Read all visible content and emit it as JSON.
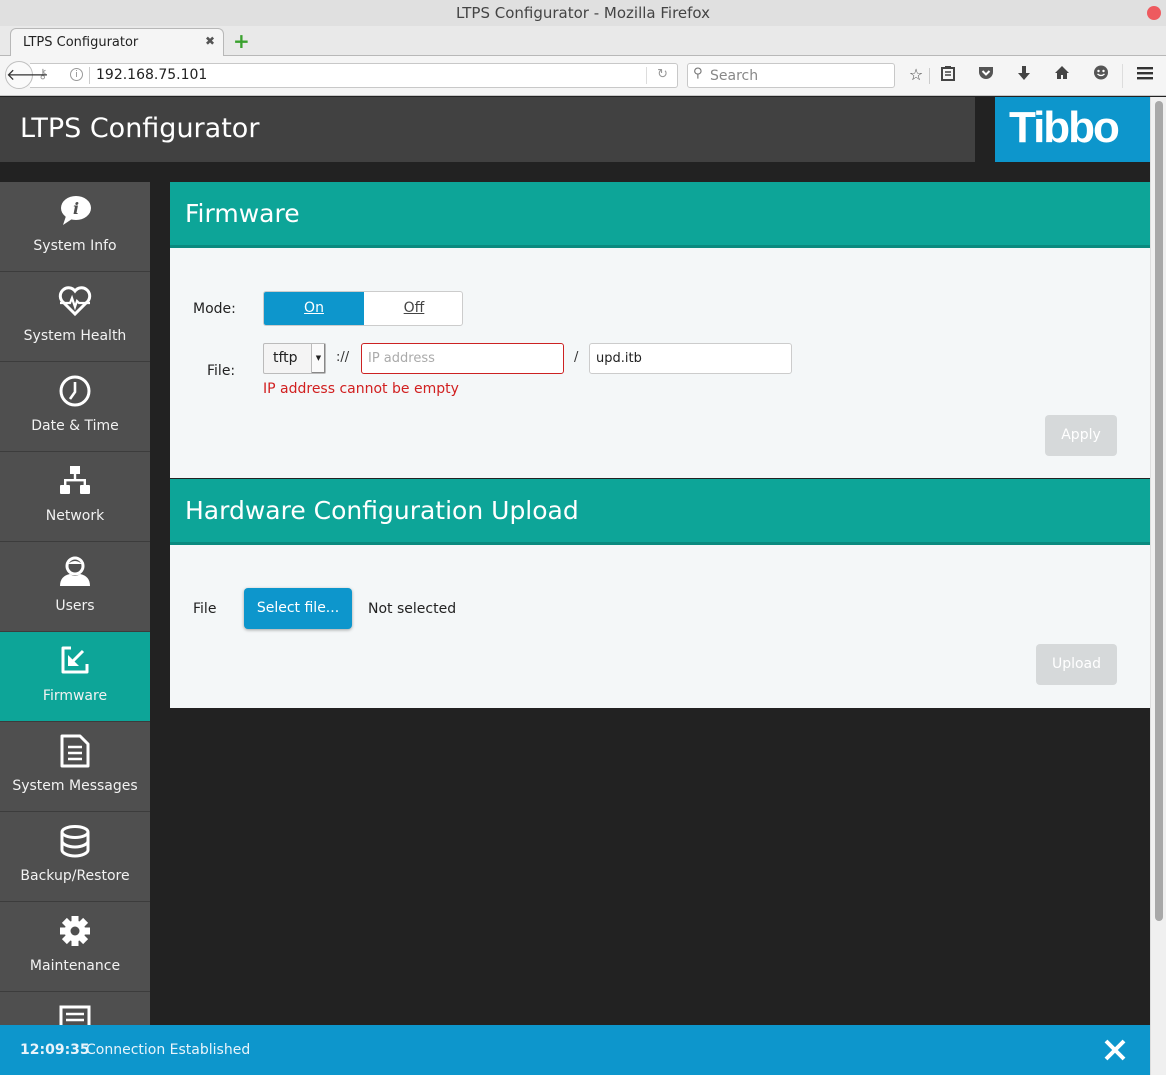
{
  "browser": {
    "window_title": "LTPS Configurator - Mozilla Firefox",
    "tab_title": "LTPS Configurator",
    "url": "192.168.75.101",
    "search_placeholder": "Search",
    "toolbar_icons": [
      "bookmark-star-icon",
      "reading-list-icon",
      "pocket-icon",
      "download-icon",
      "home-icon",
      "hello-chat-icon",
      "hamburger-menu-icon"
    ]
  },
  "app": {
    "title": "LTPS Configurator",
    "logo": "Tibbo"
  },
  "sidebar": {
    "items": [
      {
        "label": "System Info",
        "icon": "info-bubble-icon",
        "active": false
      },
      {
        "label": "System Health",
        "icon": "heart-pulse-icon",
        "active": false
      },
      {
        "label": "Date & Time",
        "icon": "clock-icon",
        "active": false
      },
      {
        "label": "Network",
        "icon": "network-tree-icon",
        "active": false
      },
      {
        "label": "Users",
        "icon": "user-icon",
        "active": false
      },
      {
        "label": "Firmware",
        "icon": "firmware-download-icon",
        "active": true
      },
      {
        "label": "System Messages",
        "icon": "document-icon",
        "active": false
      },
      {
        "label": "Backup/Restore",
        "icon": "database-icon",
        "active": false
      },
      {
        "label": "Maintenance",
        "icon": "gear-icon",
        "active": false
      },
      {
        "label": "",
        "icon": "server-icon",
        "active": false
      }
    ]
  },
  "firmware": {
    "title": "Firmware",
    "mode_label": "Mode:",
    "mode_on": "On",
    "mode_off": "Off",
    "mode_selected": "On",
    "file_label": "File:",
    "protocol": "tftp",
    "scheme_separator": "://",
    "ip_placeholder": "IP address",
    "ip_value": "",
    "path_separator": "/",
    "path_value": "upd.itb",
    "error": "IP address cannot be empty",
    "apply_label": "Apply"
  },
  "hw_upload": {
    "title": "Hardware Configuration Upload",
    "file_label": "File",
    "select_label": "Select file...",
    "file_status": "Not selected",
    "upload_label": "Upload"
  },
  "status": {
    "time": "12:09:35",
    "message": "Connection Established"
  },
  "colors": {
    "accent_teal": "#0da598",
    "accent_blue": "#0d96cc",
    "error_red": "#d12020",
    "sidebar_bg": "#4f4f4f"
  }
}
